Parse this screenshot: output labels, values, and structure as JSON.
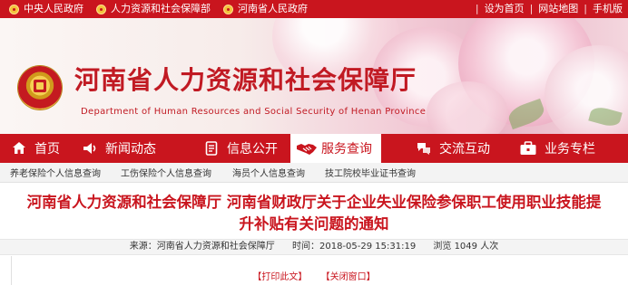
{
  "topbar": {
    "links": [
      "中央人民政府",
      "人力资源和社会保障部",
      "河南省人民政府"
    ],
    "right": [
      "设为首页",
      "网站地图",
      "手机版"
    ],
    "separator": "|"
  },
  "banner": {
    "title": "河南省人力资源和社会保障厅",
    "subtitle": "Department of Human Resources and Social Security of Henan Province"
  },
  "nav": {
    "items": [
      "首页",
      "新闻动态",
      "信息公开",
      "服务查询",
      "交流互动",
      "业务专栏"
    ],
    "active_index": 3
  },
  "subnav": {
    "items": [
      "养老保险个人信息查询",
      "工伤保险个人信息查询",
      "海员个人信息查询",
      "技工院校毕业证书查询"
    ]
  },
  "article": {
    "title_line1": "河南省人力资源和社会保障厅 河南省财政厅关于企业失业保险参保职工使用职业技能提",
    "title_line2": "升补贴有关问题的通知",
    "source": "来源：河南省人力资源和社会保障厅",
    "time": "时间：2018-05-29 15:31:19",
    "views": "浏览 1049 人次",
    "print_label": "【打印此文】",
    "close_label": "【关闭窗口】"
  },
  "colors": {
    "brand_red": "#c9151e",
    "nav_active_bg": "#ffffff"
  }
}
